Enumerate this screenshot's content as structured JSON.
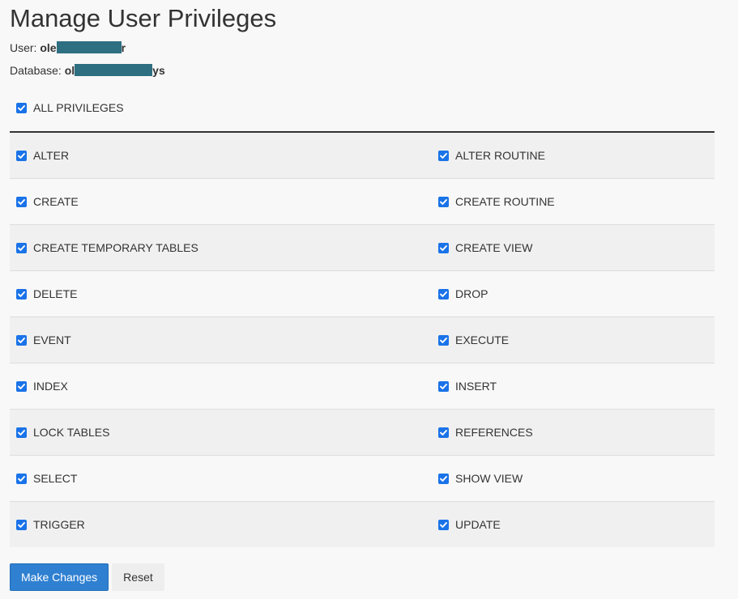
{
  "page": {
    "title": "Manage User Privileges"
  },
  "meta": {
    "user_label": "User:",
    "user_prefix": "ole",
    "user_suffix": "r",
    "database_label": "Database:",
    "database_prefix": "ol",
    "database_suffix": "ys",
    "redaction_color": "#2e6f82"
  },
  "all_privileges": {
    "label": "ALL PRIVILEGES",
    "checked": true
  },
  "privileges": {
    "rows": [
      {
        "left": "ALTER",
        "right": "ALTER ROUTINE"
      },
      {
        "left": "CREATE",
        "right": "CREATE ROUTINE"
      },
      {
        "left": "CREATE TEMPORARY TABLES",
        "right": "CREATE VIEW"
      },
      {
        "left": "DELETE",
        "right": "DROP"
      },
      {
        "left": "EVENT",
        "right": "EXECUTE"
      },
      {
        "left": "INDEX",
        "right": "INSERT"
      },
      {
        "left": "LOCK TABLES",
        "right": "REFERENCES"
      },
      {
        "left": "SELECT",
        "right": "SHOW VIEW"
      },
      {
        "left": "TRIGGER",
        "right": "UPDATE"
      }
    ]
  },
  "actions": {
    "make_changes_label": "Make Changes",
    "reset_label": "Reset"
  },
  "colors": {
    "checkbox": "#1a73e8",
    "primary_button": "#2f80d1"
  }
}
